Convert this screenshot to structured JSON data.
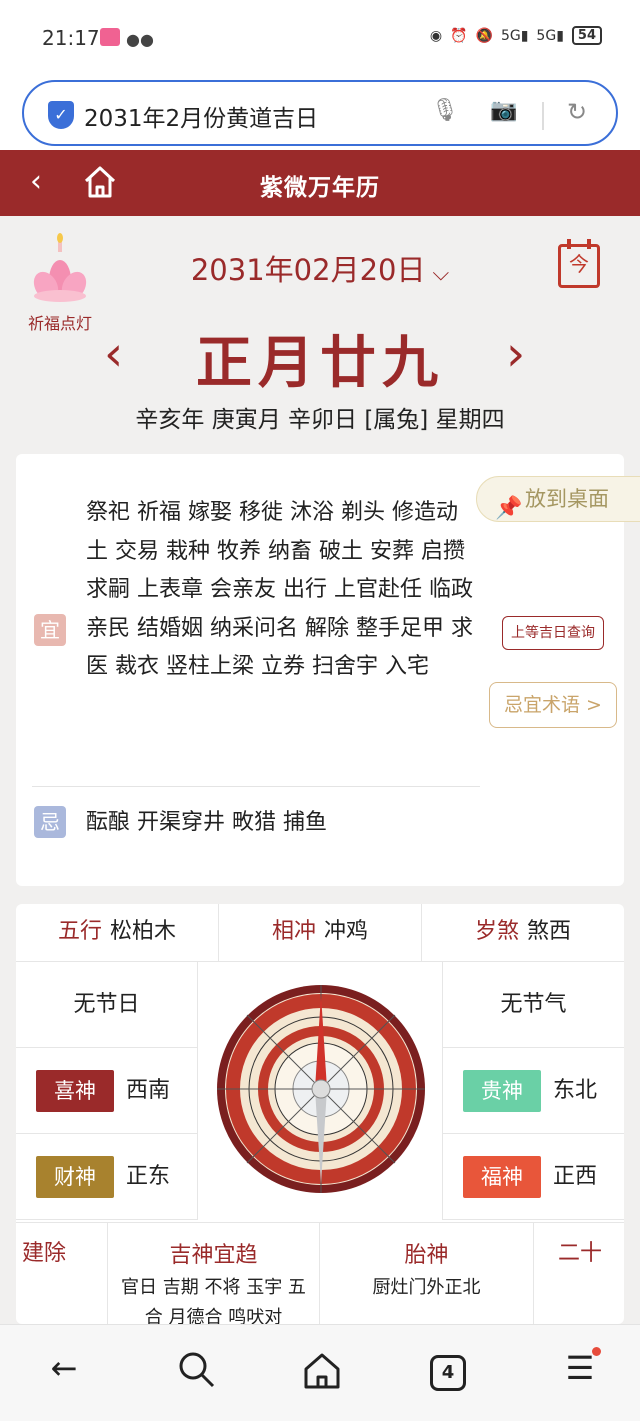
{
  "status_bar": {
    "time": "21:17",
    "signal1": "5G",
    "signal2": "5G",
    "battery": "54"
  },
  "search": {
    "query": "2031年2月份黄道吉日"
  },
  "header": {
    "title": "紫微万年历"
  },
  "lamp": {
    "label": "祈福点灯"
  },
  "date": {
    "solar": "2031年02月20日",
    "lunar": "正月廿九",
    "ganzhi": "辛亥年 庚寅月 辛卯日 [属兔] 星期四",
    "today": "今"
  },
  "yiji": {
    "yi_label": "宜",
    "yi": "祭祀 祈福 嫁娶 移徙 沐浴 剃头 修造动土 交易 栽种 牧养 纳畜 破土 安葬 启攒 求嗣 上表章 会亲友 出行 上官赴任 临政亲民 结婚姻 纳采问名 解除 整手足甲 求医 裁衣 竖柱上梁 立券 扫舍宇 入宅",
    "ji_label": "忌",
    "ji": "酝酿 开渠穿井 畋猎 捕鱼",
    "desk_button": "放到桌面",
    "top_button": "上等吉日查询",
    "ji_button": "忌宜术语 >"
  },
  "info": {
    "wuxing_k": "五行",
    "wuxing_v": "松柏木",
    "xiangchong_k": "相冲",
    "xiangchong_v": "冲鸡",
    "suisha_k": "岁煞",
    "suisha_v": "煞西",
    "no_festival": "无节日",
    "no_solar_term": "无节气",
    "xishen_k": "喜神",
    "xishen_v": "西南",
    "caishen_k": "财神",
    "caishen_v": "正东",
    "guishen_k": "贵神",
    "guishen_v": "东北",
    "fushen_k": "福神",
    "fushen_v": "正西",
    "jianchu": "建除",
    "jishen_title": "吉神宜趋",
    "jishen_body": "官日 吉期 不将 玉宇 五合 月德合 鸣吠对",
    "taishen_title": "胎神",
    "taishen_body": "厨灶门外正北",
    "ershi": "二十"
  },
  "nav": {
    "tabs_count": "4"
  },
  "colors": {
    "brand": "#9a2a2a",
    "xishen": "#9a2a2a",
    "caishen": "#a8822e",
    "guishen": "#6ad0a6",
    "fushen": "#e8563a"
  }
}
